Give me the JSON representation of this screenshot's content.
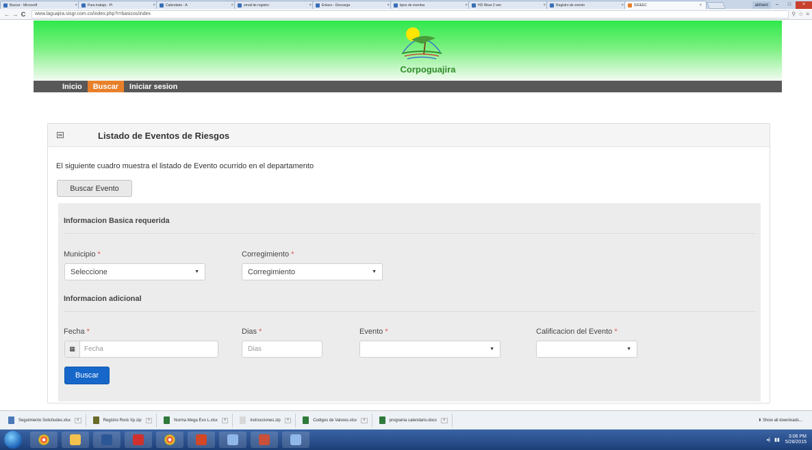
{
  "browser": {
    "tabs": [
      {
        "label": "Buscar - Microsoft",
        "active": false
      },
      {
        "label": "Para trabajo - Pi",
        "active": false
      },
      {
        "label": "Calendario - A",
        "active": false
      },
      {
        "label": "email de registro",
        "active": false
      },
      {
        "label": "Enlace - Descarga",
        "active": false
      },
      {
        "label": "tipos de eventos",
        "active": false
      },
      {
        "label": "HD Wear 2 ven",
        "active": false
      },
      {
        "label": "Registro de evento",
        "active": false
      },
      {
        "label": "SIGEEC",
        "active": true
      }
    ],
    "user_chip": "aliment",
    "url": "www.laguajira.sisgr.com.co/index.php?r=basicos/index"
  },
  "header": {
    "logo_text": "Corpoguajira"
  },
  "nav": {
    "items": [
      {
        "label": "Inicio",
        "active": false
      },
      {
        "label": "Buscar",
        "active": true
      },
      {
        "label": "Iniciar sesion",
        "active": false
      }
    ]
  },
  "panel": {
    "title": "Listado de Eventos de Riesgos",
    "intro": "El siguiente cuadro muestra el listado de Evento ocurrido en el departamento",
    "search_event_button": "Buscar Evento"
  },
  "form": {
    "basic_section": "Informacion Basica requerida",
    "additional_section": "Informacion adicional",
    "required_mark": "*",
    "municipio": {
      "label": "Municipio",
      "value": "Seleccione"
    },
    "corregimiento": {
      "label": "Corregimiento",
      "value": "Corregimiento"
    },
    "fecha": {
      "label": "Fecha",
      "placeholder": "Fecha"
    },
    "dias": {
      "label": "Dias",
      "placeholder": "Dias"
    },
    "evento": {
      "label": "Evento",
      "value": ""
    },
    "calificacion": {
      "label": "Calificacion del Evento",
      "value": ""
    },
    "submit": "Buscar"
  },
  "downloads": {
    "items": [
      "Seguimiento Solicitudes.xlsx",
      "Registro Rock Xp.zip",
      "Norma Mega Evo L.xlsx",
      "instrucciones.zip",
      "Codigos de Valores.xlsx",
      "programa calendario.docx"
    ],
    "show_all": "Show all downloads..."
  },
  "taskbar": {
    "clock_time": "3:06 PM",
    "clock_date": "5/28/2015"
  },
  "colors": {
    "header_green": "#2ee84a",
    "nav_bg": "#585858",
    "nav_active": "#e8802a",
    "primary_button": "#1667c9",
    "required": "#d9534f",
    "logo_text": "#2f8c27"
  }
}
